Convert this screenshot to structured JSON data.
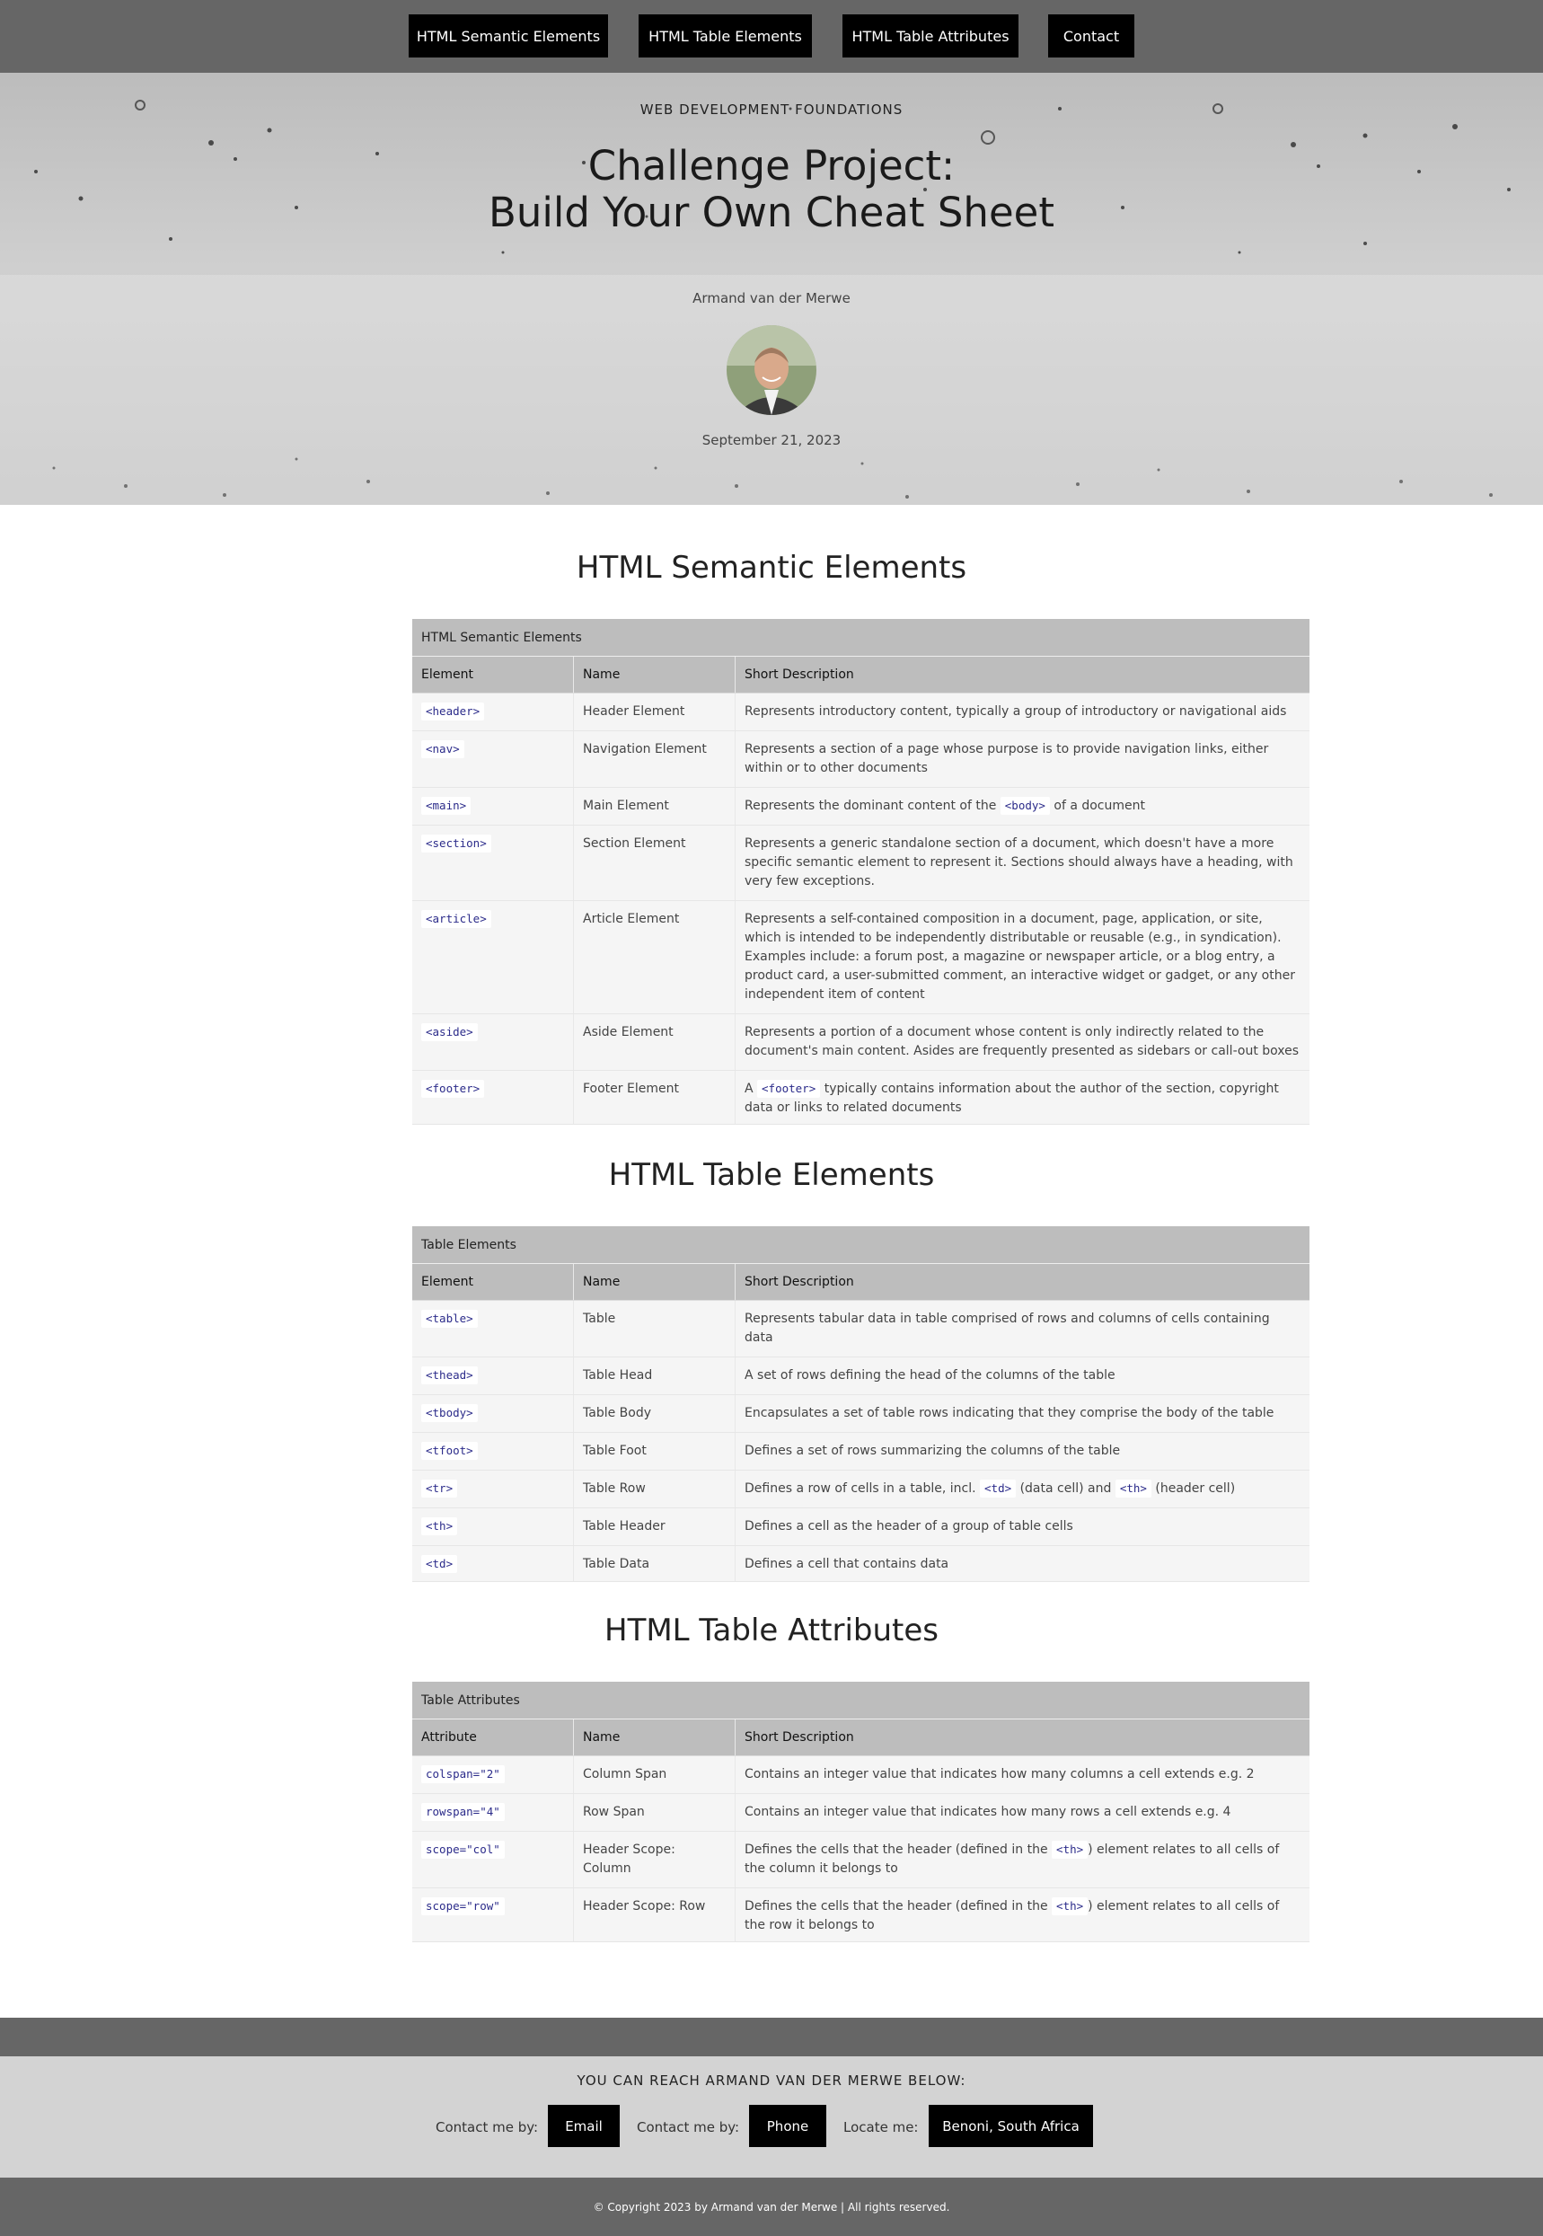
{
  "nav": {
    "items": [
      "HTML Semantic Elements",
      "HTML Table Elements",
      "HTML Table Attributes",
      "Contact"
    ]
  },
  "hero": {
    "kicker": "WEB DEVELOPMENT FOUNDATIONS",
    "title_line1": "Challenge Project:",
    "title_line2": "Build Your Own Cheat Sheet",
    "author": "Armand van der Merwe",
    "date": "September 21, 2023"
  },
  "sections": {
    "semantic": {
      "heading": "HTML Semantic Elements",
      "caption": "HTML Semantic Elements",
      "headers": [
        "Element",
        "Name",
        "Short Description"
      ],
      "rows": [
        {
          "code": "<header>",
          "name": "Header Element",
          "desc": "Represents introductory content, typically a group of introductory or navigational aids"
        },
        {
          "code": "<nav>",
          "name": "Navigation Element",
          "desc": "Represents a section of a page whose purpose is to provide navigation links, either within or to other documents"
        },
        {
          "code": "<main>",
          "name": "Main Element",
          "desc_pre": "Represents the dominant content of the ",
          "desc_code": "<body>",
          "desc_post": " of a document"
        },
        {
          "code": "<section>",
          "name": "Section Element",
          "desc": "Represents a generic standalone section of a document, which doesn't have a more specific semantic element to represent it. Sections should always have a heading, with very few exceptions."
        },
        {
          "code": "<article>",
          "name": "Article Element",
          "desc": "Represents a self-contained composition in a document, page, application, or site, which is intended to be independently distributable or reusable (e.g., in syndication). Examples include: a forum post, a magazine or newspaper article, or a blog entry, a product card, a user-submitted comment, an interactive widget or gadget, or any other independent item of content"
        },
        {
          "code": "<aside>",
          "name": "Aside Element",
          "desc": "Represents a portion of a document whose content is only indirectly related to the document's main content. Asides are frequently presented as sidebars or call-out boxes"
        },
        {
          "code": "<footer>",
          "name": "Footer Element",
          "desc_pre": "A ",
          "desc_code": "<footer>",
          "desc_post": " typically contains information about the author of the section, copyright data or links to related documents"
        }
      ]
    },
    "table_elements": {
      "heading": "HTML Table Elements",
      "caption": "Table Elements",
      "headers": [
        "Element",
        "Name",
        "Short Description"
      ],
      "rows": [
        {
          "code": "<table>",
          "name": "Table",
          "desc": "Represents tabular data in table comprised of rows and columns of cells containing data"
        },
        {
          "code": "<thead>",
          "name": "Table Head",
          "desc": "A set of rows defining the head of the columns of the table"
        },
        {
          "code": "<tbody>",
          "name": "Table Body",
          "desc": "Encapsulates a set of table rows indicating that they comprise the body of the table"
        },
        {
          "code": "<tfoot>",
          "name": "Table Foot",
          "desc": "Defines a set of rows summarizing the columns of the table"
        },
        {
          "code": "<tr>",
          "name": "Table Row",
          "desc_pre": "Defines a row of cells in a table, incl. ",
          "desc_code": "<td>",
          "desc_mid": " (data cell) and ",
          "desc_code2": "<th>",
          "desc_post": " (header cell)"
        },
        {
          "code": "<th>",
          "name": "Table Header",
          "desc": "Defines a cell as the header of a group of table cells"
        },
        {
          "code": "<td>",
          "name": "Table Data",
          "desc": "Defines a cell that contains data"
        }
      ]
    },
    "table_attributes": {
      "heading": "HTML Table Attributes",
      "caption": "Table Attributes",
      "headers": [
        "Attribute",
        "Name",
        "Short Description"
      ],
      "rows": [
        {
          "code": "colspan=\"2\"",
          "name": "Column Span",
          "desc": "Contains an integer value that indicates how many columns a cell extends e.g. 2"
        },
        {
          "code": "rowspan=\"4\"",
          "name": "Row Span",
          "desc": "Contains an integer value that indicates how many rows a cell extends e.g. 4"
        },
        {
          "code": "scope=\"col\"",
          "name": "Header Scope: Column",
          "desc_pre": "Defines the cells that the header (defined in the ",
          "desc_code": "<th>",
          "desc_post": ") element relates to all cells of the column it belongs to"
        },
        {
          "code": "scope=\"row\"",
          "name": "Header Scope: Row",
          "desc_pre": "Defines the cells that the header (defined in the ",
          "desc_code": "<th>",
          "desc_post": ") element relates to all cells of the row it belongs to"
        }
      ]
    }
  },
  "footer": {
    "heading": "YOU CAN REACH ARMAND VAN DER MERWE BELOW:",
    "contact_label_1": "Contact me by:",
    "email": "Email",
    "contact_label_2": "Contact me by:",
    "phone": "Phone",
    "locate_label": "Locate me:",
    "location": "Benoni, South Africa",
    "copyright": "© Copyright 2023 by Armand van der Merwe | All rights reserved."
  }
}
